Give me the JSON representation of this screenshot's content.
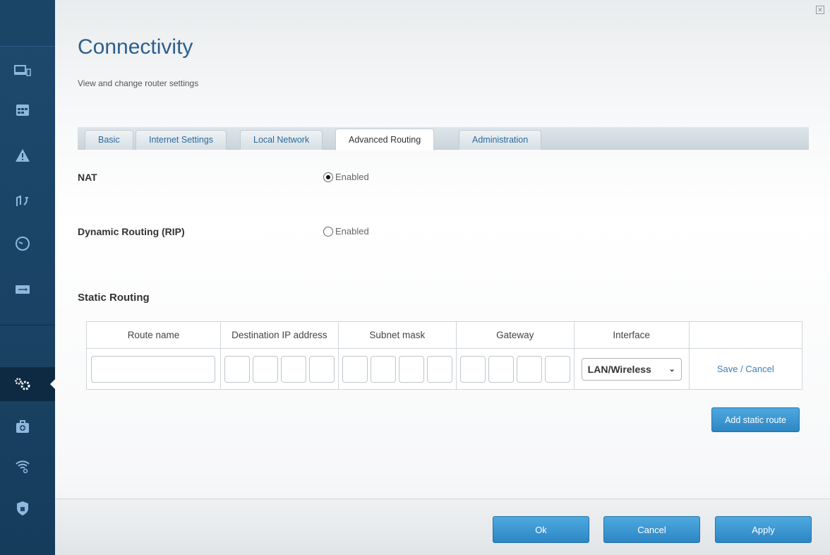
{
  "sidebar": {
    "items": [
      {
        "icon": "devices-icon"
      },
      {
        "icon": "calendar-icon"
      },
      {
        "icon": "warning-icon"
      },
      {
        "icon": "media-priority-icon"
      },
      {
        "icon": "speedometer-icon"
      },
      {
        "icon": "usb-storage-icon"
      },
      {
        "icon": "settings-gears-icon",
        "active": true
      },
      {
        "icon": "troubleshooting-icon"
      },
      {
        "icon": "wireless-icon"
      },
      {
        "icon": "security-lock-icon"
      }
    ]
  },
  "header": {
    "title": "Connectivity",
    "subtitle": "View and change router settings"
  },
  "tabs": [
    "Basic",
    "Internet Settings",
    "Local Network",
    "Advanced Routing",
    "Administration"
  ],
  "active_tab": "Advanced Routing",
  "nat": {
    "label": "NAT",
    "option": "Enabled",
    "checked": true
  },
  "rip": {
    "label": "Dynamic Routing (RIP)",
    "option": "Enabled",
    "checked": false
  },
  "static_routing": {
    "title": "Static Routing",
    "columns": [
      "Route name",
      "Destination IP address",
      "Subnet mask",
      "Gateway",
      "Interface",
      ""
    ],
    "interface_value": "LAN/Wireless",
    "save_cancel": "Save / Cancel",
    "add_button": "Add static route"
  },
  "footer": {
    "ok": "Ok",
    "cancel": "Cancel",
    "apply": "Apply"
  },
  "colors": {
    "accent": "#2c86c4",
    "sidebar": "#1e4a6e",
    "title": "#2c5f8d"
  }
}
